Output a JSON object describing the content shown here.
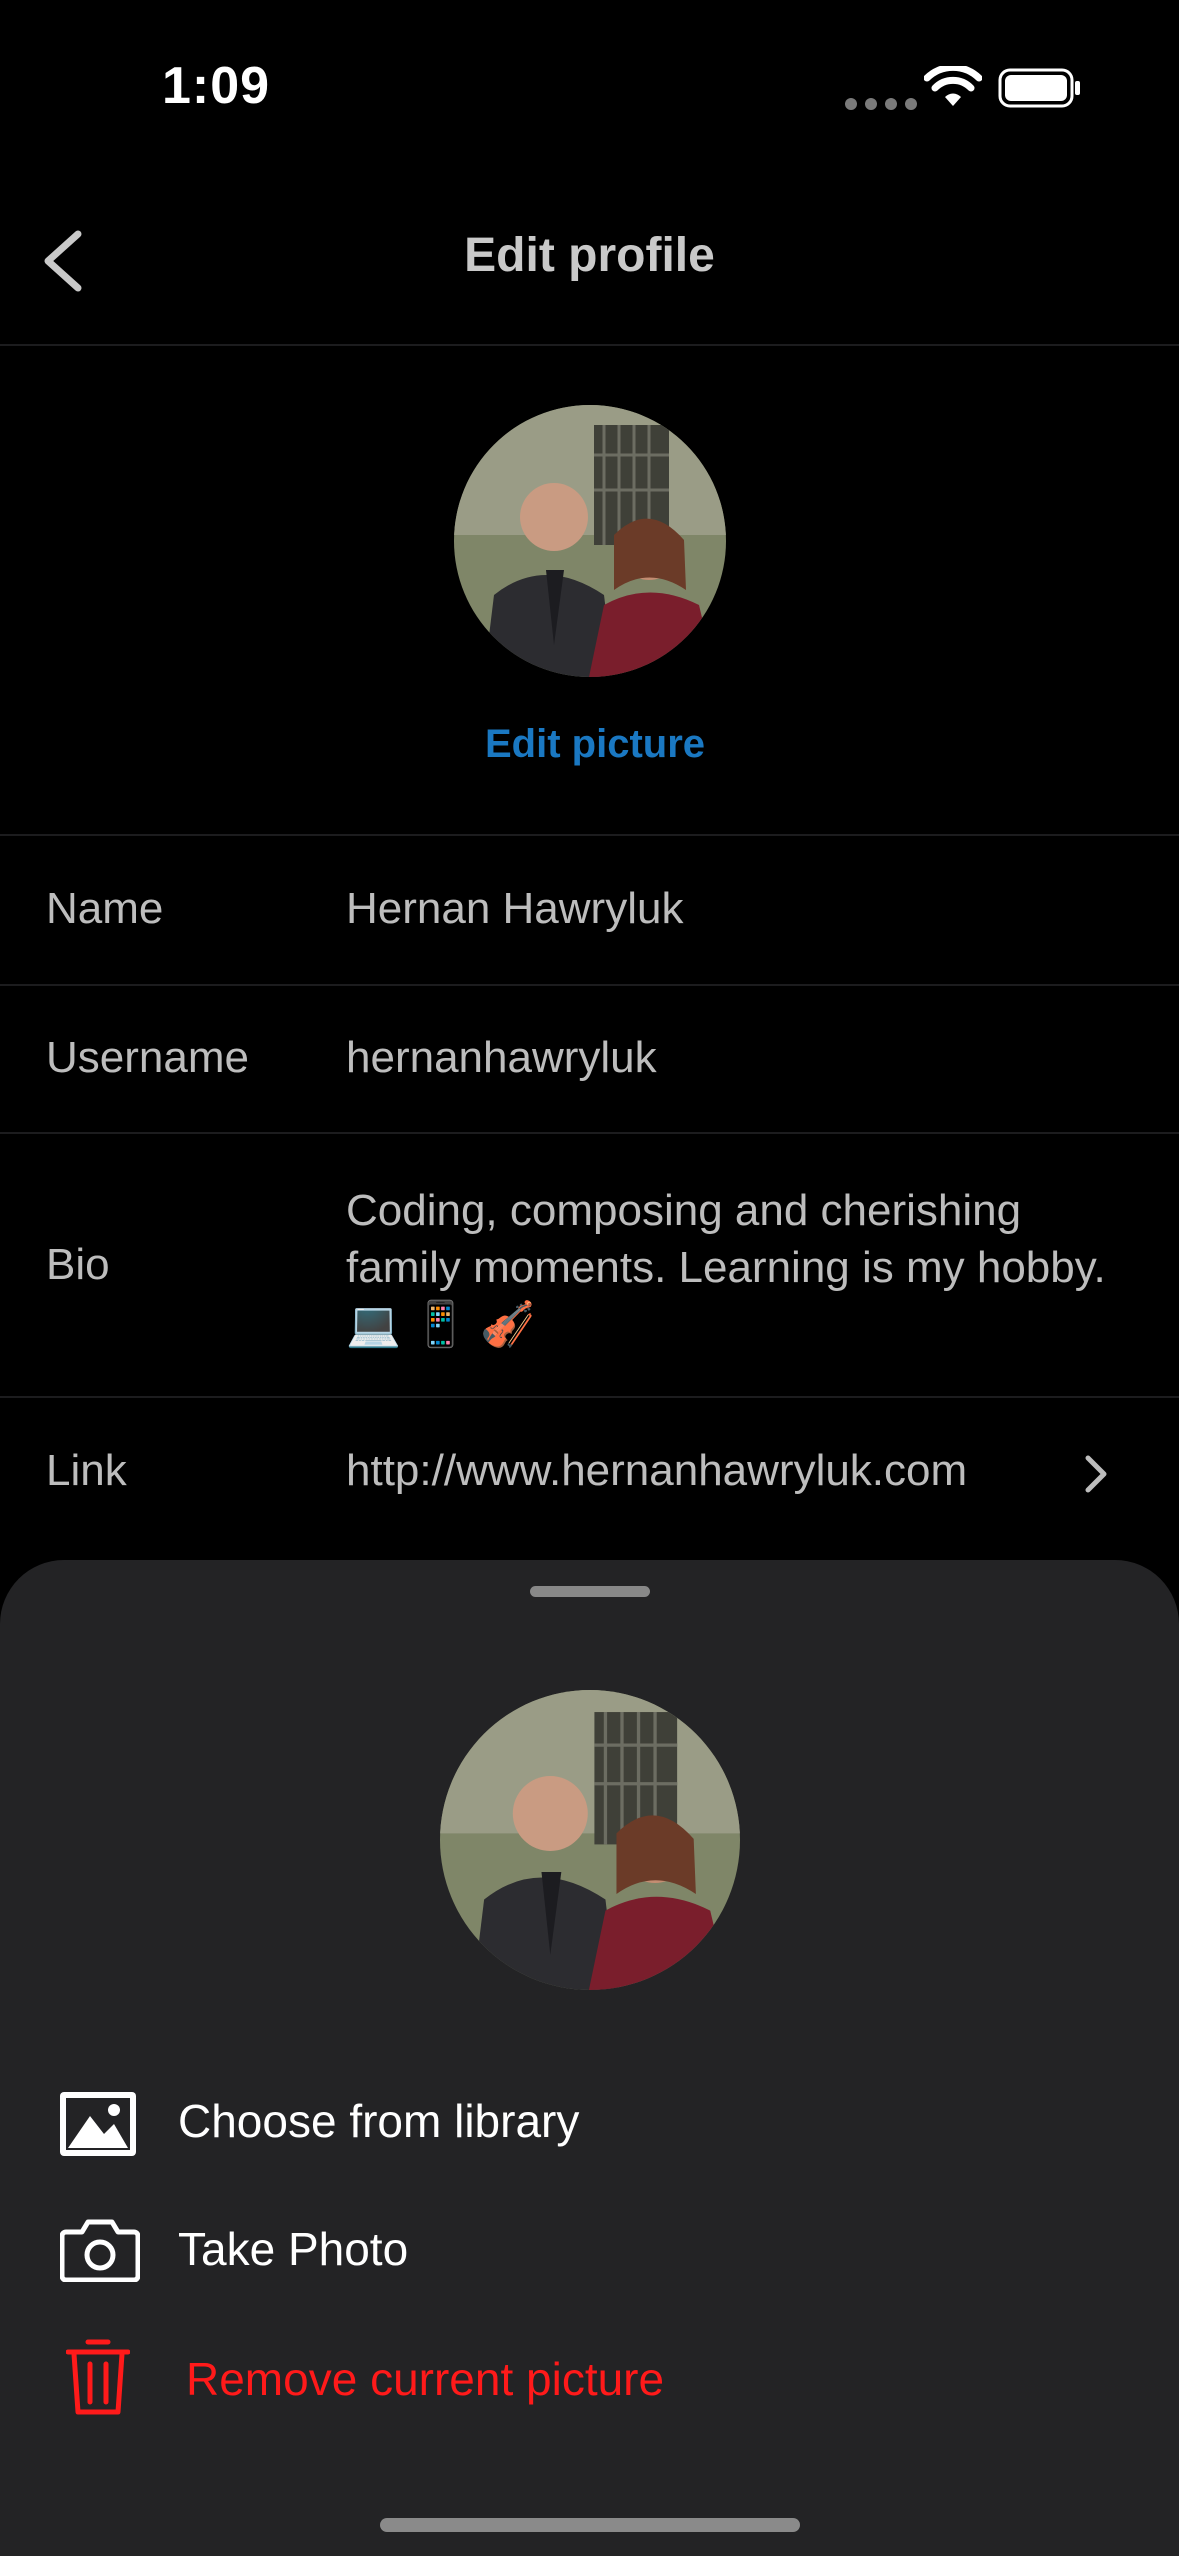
{
  "status_bar": {
    "time": "1:09"
  },
  "header": {
    "title": "Edit profile"
  },
  "profile": {
    "edit_picture_label": "Edit picture"
  },
  "fields": [
    {
      "label": "Name",
      "value": "Hernan Hawryluk"
    },
    {
      "label": "Username",
      "value": "hernanhawryluk"
    },
    {
      "label": "Bio",
      "value": "Coding, composing and cherishing family moments. Learning is my hobby. 💻 📱 🎻"
    },
    {
      "label": "Link",
      "value": "http://www.hernanhawryluk.com"
    }
  ],
  "sheet": {
    "options": [
      {
        "label": "Choose from library",
        "icon": "image-library-icon"
      },
      {
        "label": "Take Photo",
        "icon": "camera-icon"
      },
      {
        "label": "Remove current picture",
        "icon": "trash-icon"
      }
    ]
  },
  "colors": {
    "background": "#000000",
    "sheet": "#232325",
    "accent": "#1a78c2",
    "destructive": "#ff1a1a"
  }
}
